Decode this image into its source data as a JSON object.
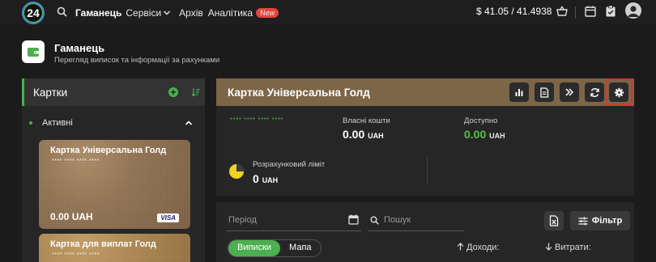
{
  "topbar": {
    "logo_text": "24",
    "nav": {
      "wallet": "Гаманець",
      "services": "Сервіси",
      "archive": "Архів",
      "analytics": "Аналітика",
      "new_badge": "New"
    },
    "rate": "$  41.05 / 41.4938"
  },
  "page": {
    "title": "Гаманець",
    "subtitle": "Перегляд виписок та інформації за рахунками"
  },
  "cards_panel": {
    "title": "Картки",
    "section_label": "Активні",
    "cards": [
      {
        "name": "Картка Універсальна Голд",
        "number": "**** **** **** ****",
        "amount": "0.00 UAH",
        "brand": "VISA"
      },
      {
        "name": "Картка для виплат Голд",
        "number": "**** **** **** ****"
      }
    ]
  },
  "card_detail": {
    "title": "Картка Універсальна Голд",
    "masked_number": "**** **** **** ****",
    "own_funds_label": "Власні кошти",
    "own_funds_value": "0.00",
    "own_funds_currency": "UAH",
    "available_label": "Доступно",
    "available_value": "0.00",
    "available_currency": "UAH",
    "credit_limit_label": "Розрахунковий ліміт",
    "credit_limit_value": "0",
    "credit_limit_currency": "UAH"
  },
  "statement": {
    "period_placeholder": "Період",
    "search_placeholder": "Пошук",
    "filter_label": "Фільтр",
    "tab_statements": "Виписки",
    "tab_map": "Мапа",
    "income_label": "Доходи:",
    "expenses_label": "Витрати:"
  },
  "colors": {
    "accent_green": "#4caf50",
    "card_header_brown": "#7d6547",
    "highlight_red": "#e03030",
    "badge_red": "#e8453c"
  }
}
